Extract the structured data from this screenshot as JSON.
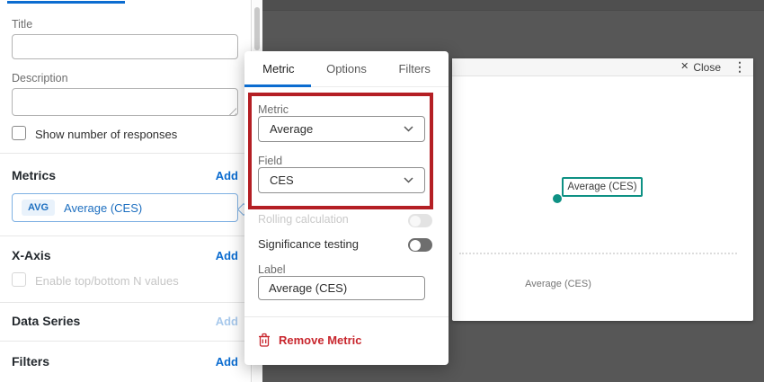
{
  "colors": {
    "accent_blue": "#0b6cd0",
    "annotation_red": "#b41f24",
    "action_red": "#c8262d",
    "teal": "#0e9184",
    "backdrop_gray": "#575757"
  },
  "sidebar": {
    "title": {
      "label": "Title",
      "value": ""
    },
    "description": {
      "label": "Description",
      "value": ""
    },
    "show_responses": {
      "label": "Show number of responses"
    },
    "metrics": {
      "heading": "Metrics",
      "add_label": "Add",
      "chip": {
        "badge": "AVG",
        "label": "Average (CES)"
      }
    },
    "x_axis": {
      "heading": "X-Axis",
      "add_label": "Add",
      "checkbox_label": "Enable top/bottom N values"
    },
    "data_series": {
      "heading": "Data Series",
      "add_label": "Add"
    },
    "filters": {
      "heading": "Filters",
      "add_label": "Add"
    }
  },
  "popup": {
    "tabs": [
      {
        "label": "Metric"
      },
      {
        "label": "Options"
      },
      {
        "label": "Filters"
      }
    ],
    "metric": {
      "label": "Metric",
      "value": "Average"
    },
    "field": {
      "label": "Field",
      "value": "CES"
    },
    "rolling": {
      "label": "Rolling calculation",
      "state": "off-disabled"
    },
    "significance": {
      "label": "Significance testing",
      "state": "off"
    },
    "label_input": {
      "label": "Label",
      "value": "Average (CES)"
    },
    "remove_label": "Remove Metric"
  },
  "preview": {
    "close_icon": "✕",
    "close_label": "Close",
    "kebab_icon": "⋮",
    "point_label": "Average (CES)",
    "x_axis_label": "Average (CES)"
  }
}
